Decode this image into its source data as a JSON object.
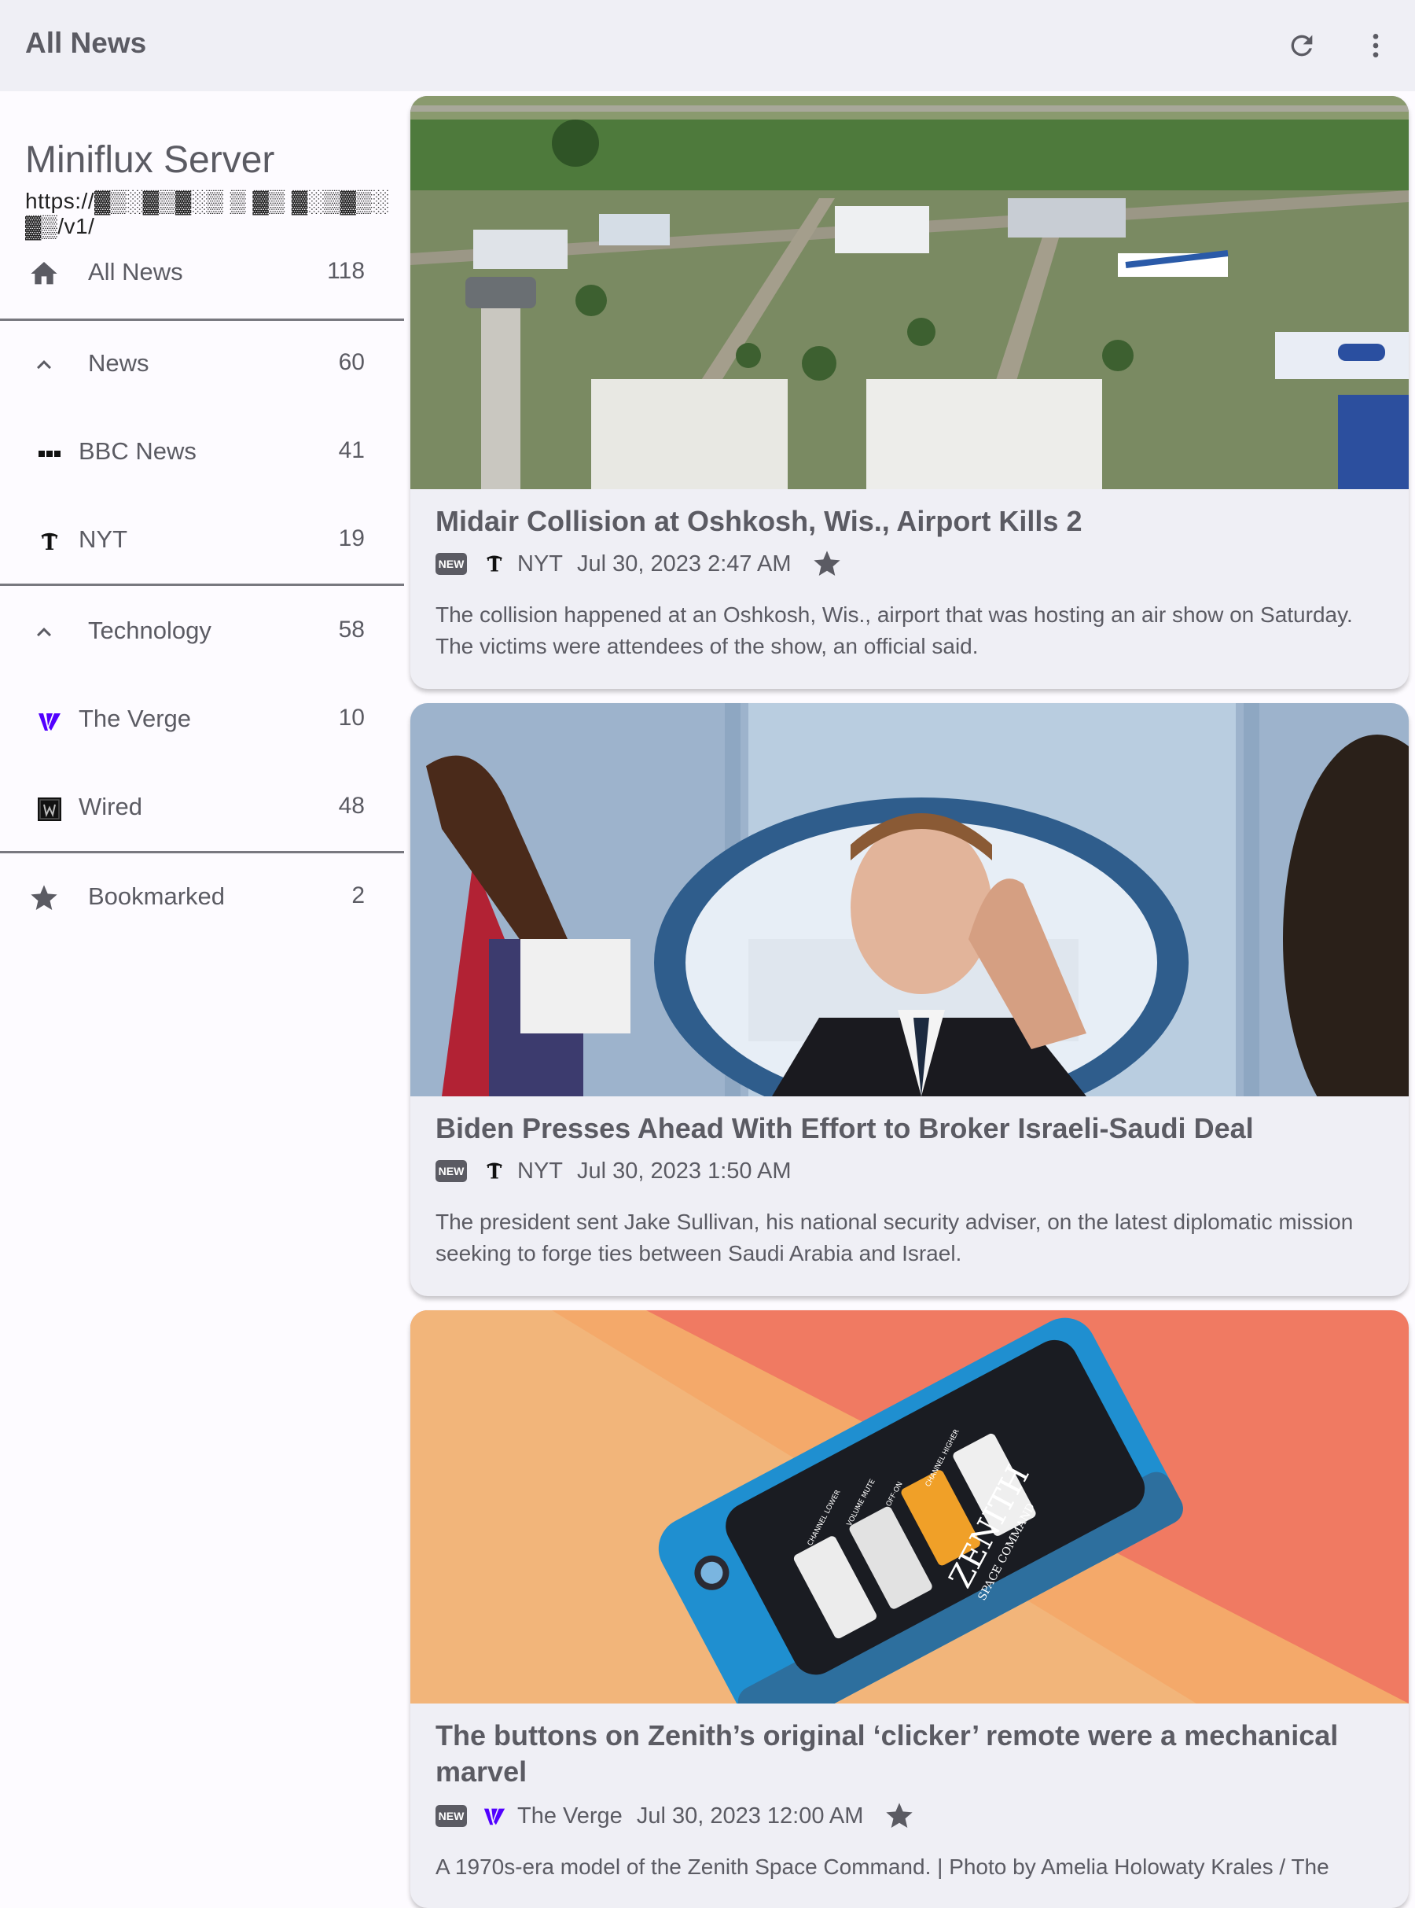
{
  "appbar": {
    "title": "All News",
    "refresh_icon": "refresh-icon",
    "menu_icon": "more-vert-icon"
  },
  "drawer": {
    "server_title": "Miniflux Server",
    "server_url": "https://▓▒░▓▒▓░▒ ▒ ▓▒ ▓░▒▓▒░ ▓▒/v1/",
    "all_news": {
      "label": "All News",
      "count": "118",
      "icon": "home-icon"
    },
    "categories": [
      {
        "label": "News",
        "count": "60",
        "icon": "chevron-up-icon",
        "feeds": [
          {
            "label": "BBC News",
            "count": "41",
            "icon": "bbc-icon"
          },
          {
            "label": "NYT",
            "count": "19",
            "icon": "nyt-icon"
          }
        ]
      },
      {
        "label": "Technology",
        "count": "58",
        "icon": "chevron-up-icon",
        "feeds": [
          {
            "label": "The Verge",
            "count": "10",
            "icon": "verge-icon"
          },
          {
            "label": "Wired",
            "count": "48",
            "icon": "wired-icon"
          }
        ]
      }
    ],
    "bookmarked": {
      "label": "Bookmarked",
      "count": "2",
      "icon": "star-icon"
    }
  },
  "articles": [
    {
      "title": "Midair Collision at Oshkosh, Wis., Airport Kills 2",
      "badge": "NEW",
      "source": "NYT",
      "date": "Jul 30, 2023 2:47 AM",
      "bookmarked": true,
      "summary": "The collision happened at an Oshkosh, Wis., airport that was hosting an air show on Saturday. The victims were attendees of the show, an official said.",
      "image": "aerial-airshow-image"
    },
    {
      "title": "Biden Presses Ahead With Effort to Broker Israeli-Saudi Deal",
      "badge": "NEW",
      "source": "NYT",
      "date": "Jul 30, 2023 1:50 AM",
      "bookmarked": false,
      "summary": "The president sent Jake Sullivan, his national security adviser, on the latest diplomatic mission seeking to forge ties between Saudi Arabia and Israel.",
      "image": "press-briefing-image"
    },
    {
      "title": "The buttons on Zenith’s original ‘clicker’ remote were a mechanical marvel",
      "badge": "NEW",
      "source": "The Verge",
      "date": "Jul 30, 2023 12:00 AM",
      "bookmarked": true,
      "summary": "A 1970s-era model of the Zenith Space Command. | Photo by Amelia Holowaty Krales / The",
      "image": "zenith-remote-image",
      "image_text": {
        "brand": "ZENITH",
        "model": "SPACE COMMAND",
        "btn1": "CHANNEL LOWER",
        "btn2": "VOLUME MUTE",
        "btn3": "OFF·ON",
        "btn4": "CHANNEL HIGHER"
      }
    }
  ],
  "colors": {
    "appbar_bg": "#efeff5",
    "card_bg": "#efeff5",
    "text": "#5b5b63",
    "verge_accent": "#5200ff"
  }
}
